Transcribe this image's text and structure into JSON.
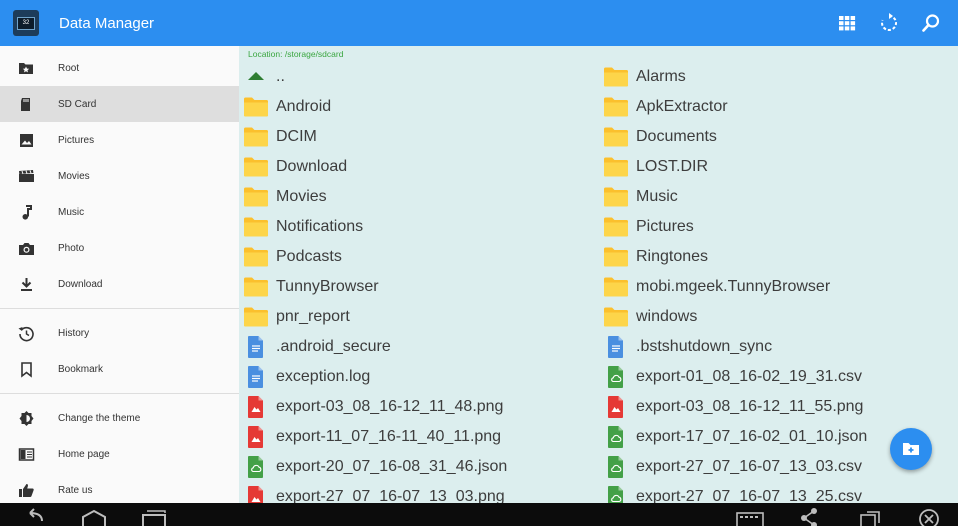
{
  "app": {
    "title": "Data Manager"
  },
  "toolbar": {
    "actions": [
      "grid-view-icon",
      "refresh-icon",
      "search-icon"
    ]
  },
  "sidebar": {
    "groups": [
      [
        {
          "label": "Root",
          "icon": "star-folder-icon"
        },
        {
          "label": "SD Card",
          "icon": "sd-card-icon",
          "active": true
        },
        {
          "label": "Pictures",
          "icon": "image-icon"
        },
        {
          "label": "Movies",
          "icon": "movie-icon"
        },
        {
          "label": "Music",
          "icon": "music-note-icon"
        },
        {
          "label": "Photo",
          "icon": "camera-icon"
        },
        {
          "label": "Download",
          "icon": "download-icon"
        }
      ],
      [
        {
          "label": "History",
          "icon": "history-icon"
        },
        {
          "label": "Bookmark",
          "icon": "bookmark-icon"
        }
      ],
      [
        {
          "label": "Change the theme",
          "icon": "theme-icon"
        },
        {
          "label": "Home page",
          "icon": "home-page-icon"
        },
        {
          "label": "Rate us",
          "icon": "thumbs-up-icon"
        }
      ]
    ]
  },
  "content": {
    "location": "Location: /storage/sdcard",
    "files": [
      {
        "name": "..",
        "type": "up"
      },
      {
        "name": "Alarms",
        "type": "folder"
      },
      {
        "name": "Android",
        "type": "folder"
      },
      {
        "name": "ApkExtractor",
        "type": "folder"
      },
      {
        "name": "DCIM",
        "type": "folder"
      },
      {
        "name": "Documents",
        "type": "folder"
      },
      {
        "name": "Download",
        "type": "folder"
      },
      {
        "name": "LOST.DIR",
        "type": "folder"
      },
      {
        "name": "Movies",
        "type": "folder"
      },
      {
        "name": "Music",
        "type": "folder"
      },
      {
        "name": "Notifications",
        "type": "folder"
      },
      {
        "name": "Pictures",
        "type": "folder"
      },
      {
        "name": "Podcasts",
        "type": "folder"
      },
      {
        "name": "Ringtones",
        "type": "folder"
      },
      {
        "name": "TunnyBrowser",
        "type": "folder"
      },
      {
        "name": "mobi.mgeek.TunnyBrowser",
        "type": "folder"
      },
      {
        "name": "pnr_report",
        "type": "folder"
      },
      {
        "name": "windows",
        "type": "folder"
      },
      {
        "name": ".android_secure",
        "type": "doc"
      },
      {
        "name": ".bstshutdown_sync",
        "type": "doc"
      },
      {
        "name": "exception.log",
        "type": "doc"
      },
      {
        "name": "export-01_08_16-02_19_31.csv",
        "type": "csv"
      },
      {
        "name": "export-03_08_16-12_11_48.png",
        "type": "image"
      },
      {
        "name": "export-03_08_16-12_11_55.png",
        "type": "image"
      },
      {
        "name": "export-11_07_16-11_40_11.png",
        "type": "image"
      },
      {
        "name": "export-17_07_16-02_01_10.json",
        "type": "csv"
      },
      {
        "name": "export-20_07_16-08_31_46.json",
        "type": "csv"
      },
      {
        "name": "export-27_07_16-07_13_03.csv",
        "type": "csv"
      },
      {
        "name": "export-27_07_16-07_13_03.png",
        "type": "image"
      },
      {
        "name": "export-27_07_16-07_13_25.csv",
        "type": "csv"
      }
    ]
  },
  "fab": {
    "icon": "new-folder-icon"
  },
  "navbar": {
    "buttons": [
      "back-icon",
      "home-icon",
      "recents-icon",
      "keyboard-icon",
      "share-icon",
      "rotate-screen-icon",
      "close-icon"
    ]
  },
  "colors": {
    "accent": "#2c8ef0",
    "folder": "#fbc02d",
    "doc": "#4a8fe0",
    "image": "#e53935",
    "csv": "#43a047",
    "location": "#3aa640"
  }
}
